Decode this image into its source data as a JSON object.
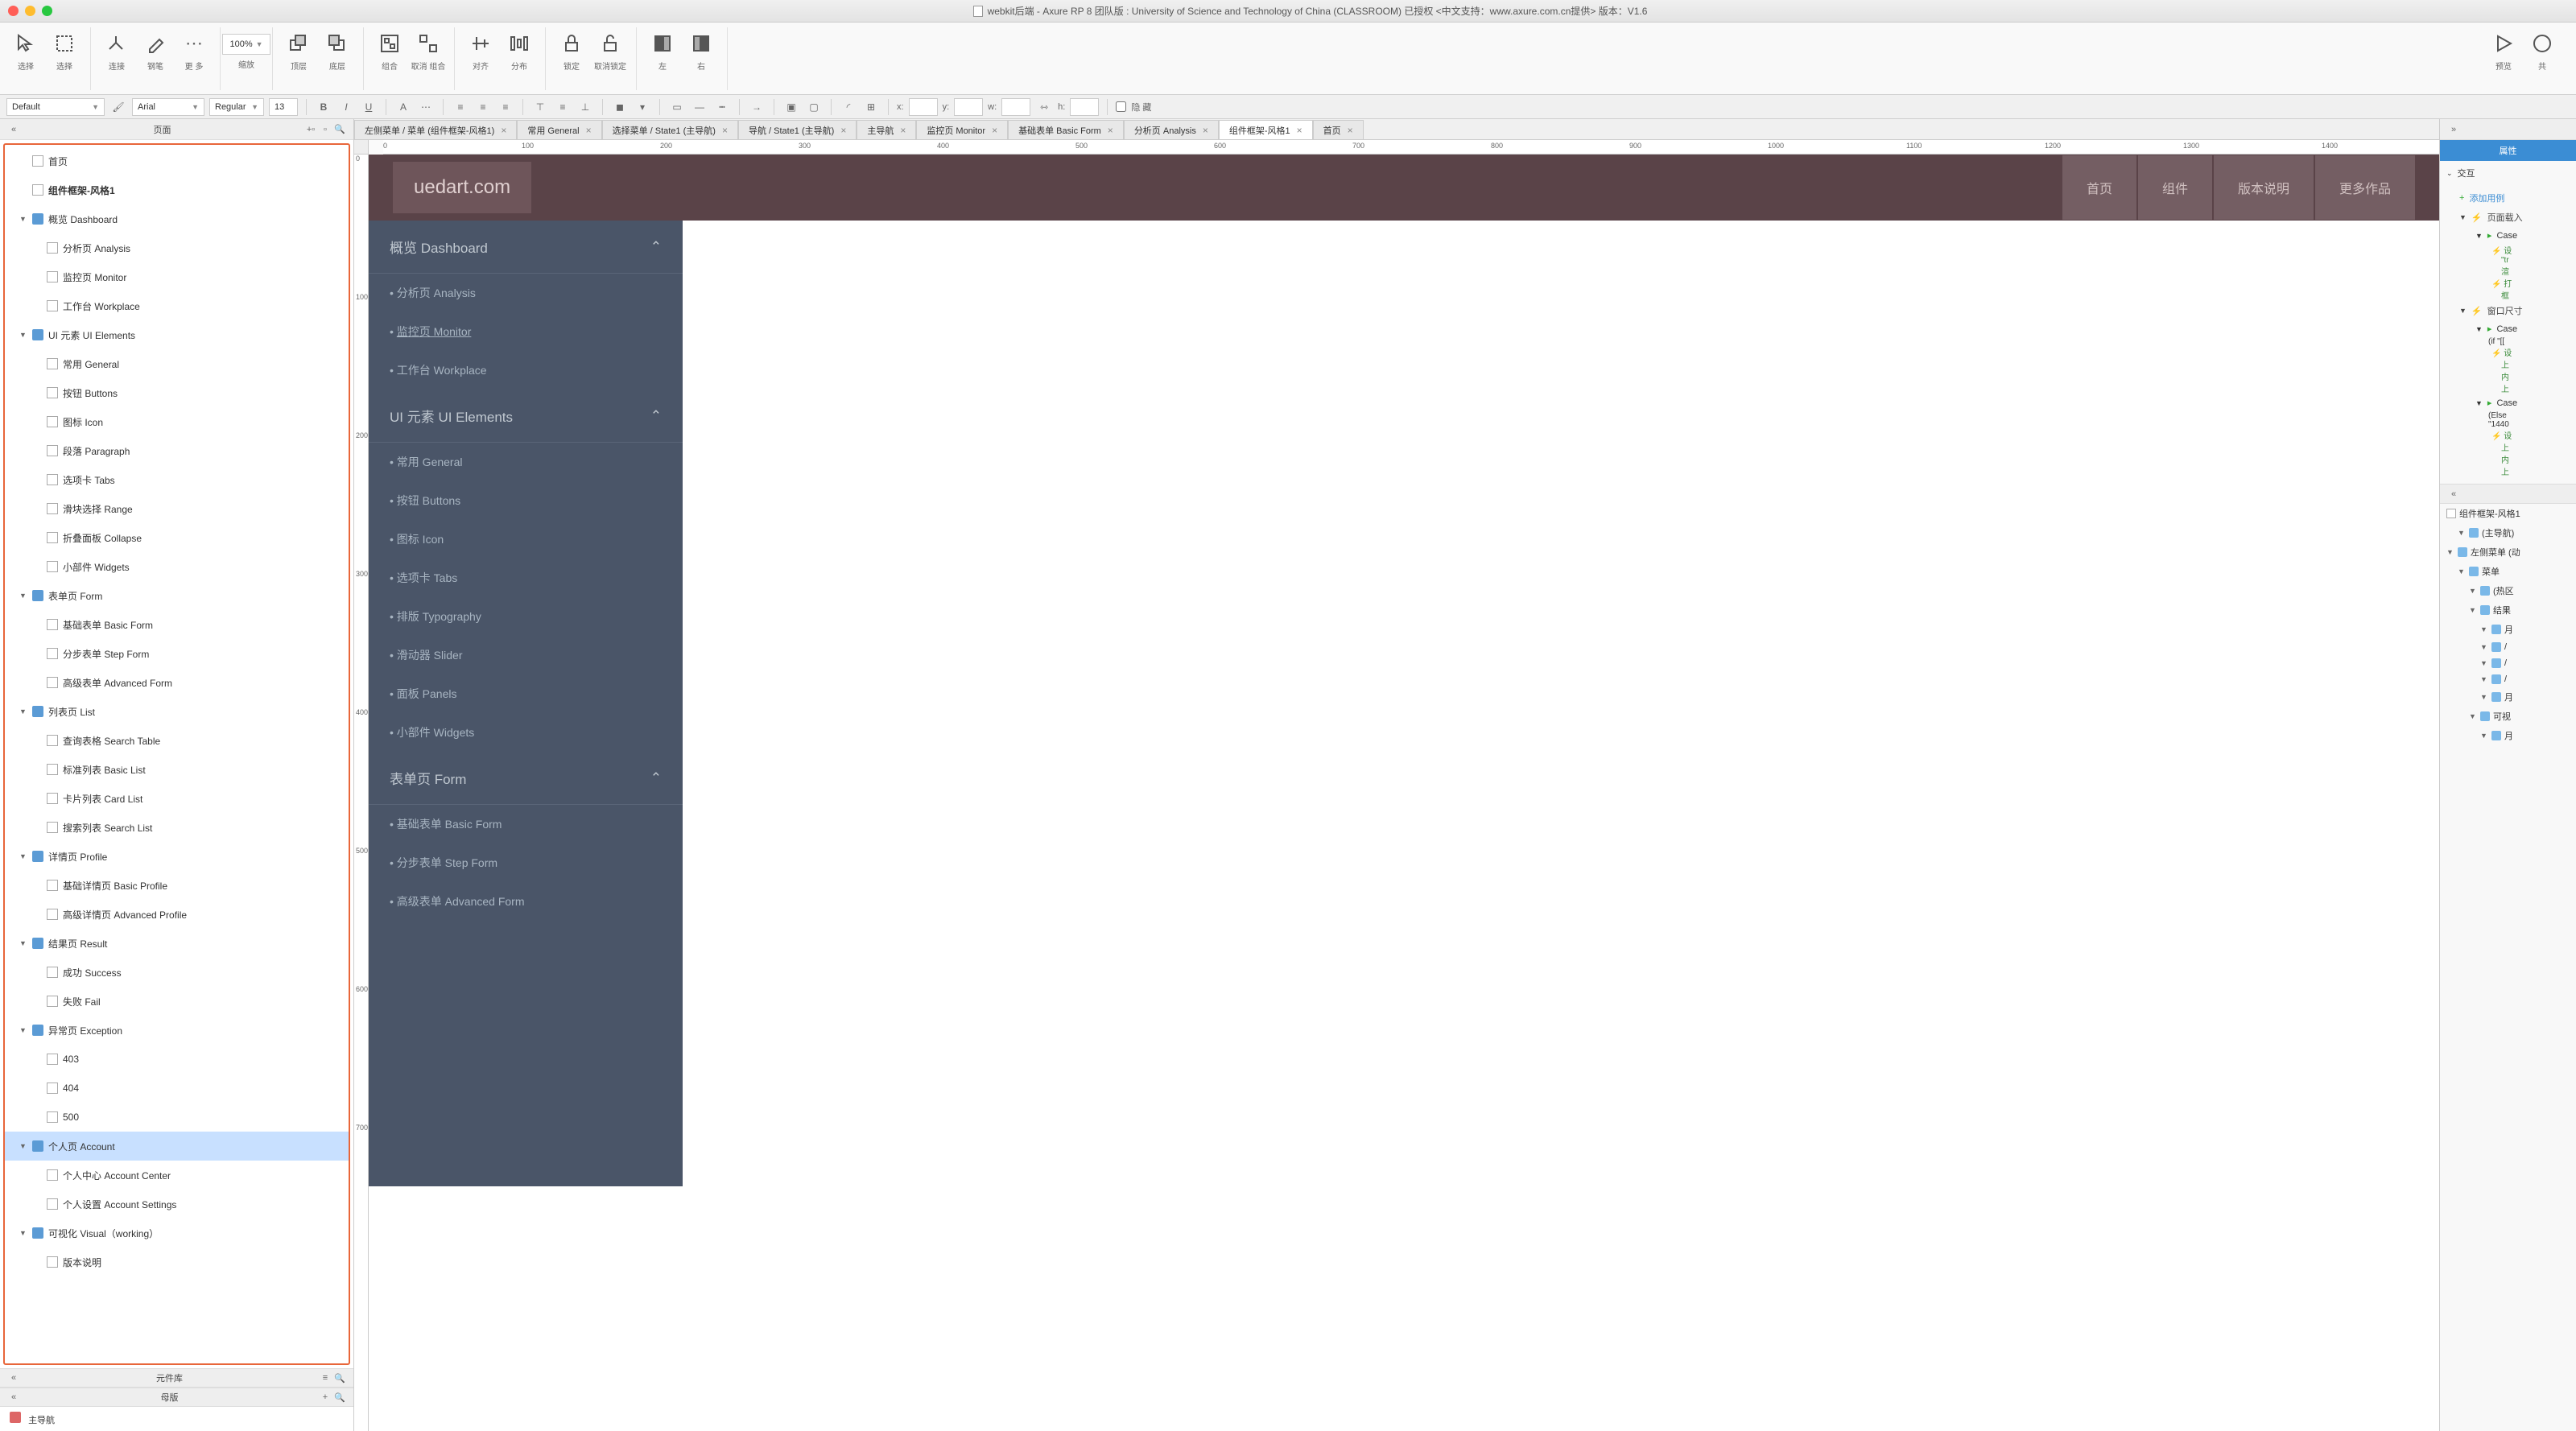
{
  "titlebar": {
    "full_title": "webkit后端 - Axure RP 8 团队版 : University of Science and Technology of China (CLASSROOM) 已授权   <中文支持：www.axure.com.cn提供> 版本：V1.6"
  },
  "toolbar": {
    "select": "选择",
    "selected": "选择",
    "connect": "连接",
    "pen": "钢笔",
    "more": "更 多",
    "zoom_value": "100%",
    "zoom_label": "缩放",
    "top": "顶层",
    "bottom": "底层",
    "group": "组合",
    "ungroup": "取消 组合",
    "align": "对齐",
    "distribute": "分布",
    "lock": "锁定",
    "unlock": "取消锁定",
    "left": "左",
    "right": "右",
    "preview": "预览",
    "share": "共"
  },
  "formatbar": {
    "style": "Default",
    "font": "Arial",
    "weight": "Regular",
    "size": "13",
    "x_label": "x:",
    "y_label": "y:",
    "w_label": "w:",
    "h_label": "h:",
    "hidden": "隐 藏"
  },
  "left_panel": {
    "pages_title": "页面",
    "widgets_title": "元件库",
    "masters_title": "母版",
    "master_item": "主导航"
  },
  "tree": [
    {
      "l": 0,
      "t": "page",
      "n": "首页"
    },
    {
      "l": 0,
      "t": "page",
      "n": "组件框架-风格1",
      "bold": true
    },
    {
      "l": 0,
      "t": "folder",
      "n": "概览 Dashboard",
      "open": true
    },
    {
      "l": 1,
      "t": "page",
      "n": "分析页 Analysis"
    },
    {
      "l": 1,
      "t": "page",
      "n": "监控页 Monitor"
    },
    {
      "l": 1,
      "t": "page",
      "n": "工作台 Workplace"
    },
    {
      "l": 0,
      "t": "folder",
      "n": "UI 元素 UI Elements",
      "open": true
    },
    {
      "l": 1,
      "t": "page",
      "n": "常用 General"
    },
    {
      "l": 1,
      "t": "page",
      "n": "按钮 Buttons"
    },
    {
      "l": 1,
      "t": "page",
      "n": "图标 Icon"
    },
    {
      "l": 1,
      "t": "page",
      "n": "段落 Paragraph"
    },
    {
      "l": 1,
      "t": "page",
      "n": "选项卡 Tabs"
    },
    {
      "l": 1,
      "t": "page",
      "n": "滑块选择 Range"
    },
    {
      "l": 1,
      "t": "page",
      "n": "折叠面板 Collapse"
    },
    {
      "l": 1,
      "t": "page",
      "n": "小部件 Widgets"
    },
    {
      "l": 0,
      "t": "folder",
      "n": "表单页 Form",
      "open": true
    },
    {
      "l": 1,
      "t": "page",
      "n": "基础表单 Basic Form"
    },
    {
      "l": 1,
      "t": "page",
      "n": "分步表单 Step Form"
    },
    {
      "l": 1,
      "t": "page",
      "n": "高级表单 Advanced Form"
    },
    {
      "l": 0,
      "t": "folder",
      "n": "列表页 List",
      "open": true
    },
    {
      "l": 1,
      "t": "page",
      "n": "查询表格 Search Table"
    },
    {
      "l": 1,
      "t": "page",
      "n": "标准列表 Basic List"
    },
    {
      "l": 1,
      "t": "page",
      "n": "卡片列表 Card List"
    },
    {
      "l": 1,
      "t": "page",
      "n": "搜索列表 Search List"
    },
    {
      "l": 0,
      "t": "folder",
      "n": "详情页 Profile",
      "open": true
    },
    {
      "l": 1,
      "t": "page",
      "n": "基础详情页 Basic Profile"
    },
    {
      "l": 1,
      "t": "page",
      "n": "高级详情页 Advanced Profile"
    },
    {
      "l": 0,
      "t": "folder",
      "n": "结果页 Result",
      "open": true
    },
    {
      "l": 1,
      "t": "page",
      "n": "成功 Success"
    },
    {
      "l": 1,
      "t": "page",
      "n": "失败 Fail"
    },
    {
      "l": 0,
      "t": "folder",
      "n": "异常页 Exception",
      "open": true
    },
    {
      "l": 1,
      "t": "page",
      "n": "403"
    },
    {
      "l": 1,
      "t": "page",
      "n": "404"
    },
    {
      "l": 1,
      "t": "page",
      "n": "500"
    },
    {
      "l": 0,
      "t": "folder",
      "n": "个人页 Account",
      "open": true,
      "selected": true
    },
    {
      "l": 1,
      "t": "page",
      "n": "个人中心 Account Center"
    },
    {
      "l": 1,
      "t": "page",
      "n": "个人设置 Account Settings"
    },
    {
      "l": 0,
      "t": "folder",
      "n": "可视化 Visual（working）",
      "open": true
    },
    {
      "l": 1,
      "t": "page",
      "n": "版本说明"
    }
  ],
  "doc_tabs": [
    {
      "n": "左侧菜单 / 菜单 (组件框架-风格1)",
      "a": false
    },
    {
      "n": "常用 General",
      "a": false
    },
    {
      "n": "选择菜单 / State1 (主导航)",
      "a": false
    },
    {
      "n": "导航 / State1 (主导航)",
      "a": false
    },
    {
      "n": "主导航",
      "a": false
    },
    {
      "n": "监控页 Monitor",
      "a": false
    },
    {
      "n": "基础表单 Basic Form",
      "a": false
    },
    {
      "n": "分析页 Analysis",
      "a": false
    },
    {
      "n": "组件框架-风格1",
      "a": true
    },
    {
      "n": "首页",
      "a": false
    }
  ],
  "ruler_h": [
    "0",
    "100",
    "200",
    "300",
    "400",
    "500",
    "600",
    "700",
    "800",
    "900",
    "1000",
    "1100",
    "1200",
    "1300",
    "1400"
  ],
  "ruler_v": [
    "0",
    "100",
    "200",
    "300",
    "400",
    "500",
    "600",
    "700"
  ],
  "mock": {
    "logo": "uedart.com",
    "nav": [
      "首页",
      "组件",
      "版本说明",
      "更多作品"
    ],
    "sections": [
      {
        "title": "概览 Dashboard",
        "items": [
          "分析页 Analysis",
          "监控页 Monitor",
          "工作台 Workplace"
        ],
        "link_idx": 1
      },
      {
        "title": "UI 元素 UI Elements",
        "items": [
          "常用 General",
          "按钮 Buttons",
          "图标 Icon",
          "选项卡 Tabs",
          "排版 Typography",
          "滑动器 Slider",
          "面板 Panels",
          "小部件 Widgets"
        ]
      },
      {
        "title": "表单页 Form",
        "items": [
          "基础表单 Basic Form",
          "分步表单 Step Form",
          "高级表单 Advanced Form"
        ]
      }
    ]
  },
  "right_panel": {
    "tab": "属性",
    "interaction": "交互",
    "add_case": "添加用例",
    "page_load": "页面载入",
    "case1": "Case",
    "action1a": "设",
    "action1a2": "\"tr",
    "action1b": "渲",
    "action1c": "打",
    "action1c2": "框",
    "window_resize": "窗口尺寸",
    "case2": "Case",
    "case2_cond": "(if \"[[",
    "action2a": "设",
    "action2b": "上",
    "action2c": "内",
    "action2d": "上",
    "case3": "Case",
    "case3_cond": "(Else",
    "case3_cond2": "\"1440",
    "action3a": "设",
    "action3b": "上",
    "action3c": "内",
    "action3d": "上",
    "outline_title": "组件框架-风格1",
    "outline": [
      {
        "l": 1,
        "n": "(主导航)"
      },
      {
        "l": 0,
        "n": "左侧菜单 (动"
      },
      {
        "l": 1,
        "n": "菜单"
      },
      {
        "l": 2,
        "n": "(热区"
      },
      {
        "l": 2,
        "n": "结果"
      },
      {
        "l": 3,
        "n": "月"
      },
      {
        "l": 3,
        "n": "/"
      },
      {
        "l": 3,
        "n": "/"
      },
      {
        "l": 3,
        "n": "/"
      },
      {
        "l": 3,
        "n": "月"
      },
      {
        "l": 2,
        "n": "可视"
      },
      {
        "l": 3,
        "n": "月"
      }
    ]
  }
}
